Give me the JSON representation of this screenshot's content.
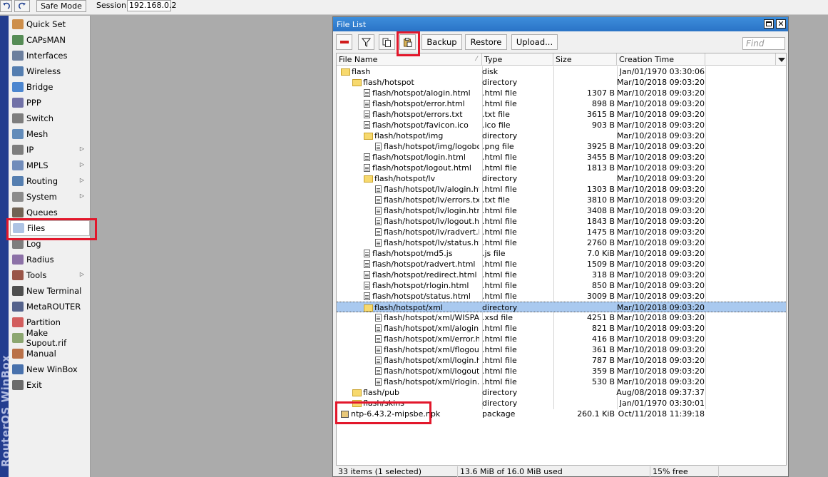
{
  "toolbar": {
    "undo_icon": "undo-icon",
    "redo_icon": "redo-icon",
    "safe_mode_label": "Safe Mode",
    "session_label": "Session:",
    "session_value": "192.168.0.2"
  },
  "brand_strip": "RouterOS WinBox",
  "sidebar": {
    "items": [
      {
        "label": "Quick Set",
        "icon": "quick-set-icon"
      },
      {
        "label": "CAPsMAN",
        "icon": "capsman-icon"
      },
      {
        "label": "Interfaces",
        "icon": "interfaces-icon"
      },
      {
        "label": "Wireless",
        "icon": "wireless-icon"
      },
      {
        "label": "Bridge",
        "icon": "bridge-icon"
      },
      {
        "label": "PPP",
        "icon": "ppp-icon"
      },
      {
        "label": "Switch",
        "icon": "switch-icon"
      },
      {
        "label": "Mesh",
        "icon": "mesh-icon"
      },
      {
        "label": "IP",
        "icon": "ip-icon",
        "submenu": true
      },
      {
        "label": "MPLS",
        "icon": "mpls-icon",
        "submenu": true
      },
      {
        "label": "Routing",
        "icon": "routing-icon",
        "submenu": true
      },
      {
        "label": "System",
        "icon": "system-icon",
        "submenu": true
      },
      {
        "label": "Queues",
        "icon": "queues-icon"
      },
      {
        "label": "Files",
        "icon": "files-icon",
        "selected": true
      },
      {
        "label": "Log",
        "icon": "log-icon"
      },
      {
        "label": "Radius",
        "icon": "radius-icon"
      },
      {
        "label": "Tools",
        "icon": "tools-icon",
        "submenu": true
      },
      {
        "label": "New Terminal",
        "icon": "terminal-icon"
      },
      {
        "label": "MetaROUTER",
        "icon": "metarouter-icon"
      },
      {
        "label": "Partition",
        "icon": "partition-icon"
      },
      {
        "label": "Make Supout.rif",
        "icon": "supout-icon"
      },
      {
        "label": "Manual",
        "icon": "manual-icon"
      },
      {
        "label": "New WinBox",
        "icon": "winbox-icon"
      },
      {
        "label": "Exit",
        "icon": "exit-icon"
      }
    ]
  },
  "file_window": {
    "title": "File List",
    "buttons": {
      "remove_icon": "remove-icon",
      "filter_icon": "filter-icon",
      "copy_icon": "copy-icon",
      "paste_icon": "paste-icon",
      "backup": "Backup",
      "restore": "Restore",
      "upload": "Upload..."
    },
    "find_placeholder": "Find",
    "columns": [
      "File Name",
      "Type",
      "Size",
      "Creation Time"
    ],
    "rows": [
      {
        "name": "flash",
        "type": "disk",
        "size": "",
        "time": "Jan/01/1970 03:30:06",
        "icon": "folder",
        "indent": 0
      },
      {
        "name": "flash/hotspot",
        "type": "directory",
        "size": "",
        "time": "Mar/10/2018 09:03:20",
        "icon": "folder",
        "indent": 1
      },
      {
        "name": "flash/hotspot/alogin.html",
        "type": ".html file",
        "size": "1307 B",
        "time": "Mar/10/2018 09:03:20",
        "icon": "file",
        "indent": 2
      },
      {
        "name": "flash/hotspot/error.html",
        "type": ".html file",
        "size": "898 B",
        "time": "Mar/10/2018 09:03:20",
        "icon": "file",
        "indent": 2
      },
      {
        "name": "flash/hotspot/errors.txt",
        "type": ".txt file",
        "size": "3615 B",
        "time": "Mar/10/2018 09:03:20",
        "icon": "file",
        "indent": 2
      },
      {
        "name": "flash/hotspot/favicon.ico",
        "type": ".ico file",
        "size": "903 B",
        "time": "Mar/10/2018 09:03:20",
        "icon": "file",
        "indent": 2
      },
      {
        "name": "flash/hotspot/img",
        "type": "directory",
        "size": "",
        "time": "Mar/10/2018 09:03:20",
        "icon": "folder",
        "indent": 2
      },
      {
        "name": "flash/hotspot/img/logobo...",
        "type": ".png file",
        "size": "3925 B",
        "time": "Mar/10/2018 09:03:20",
        "icon": "file",
        "indent": 3
      },
      {
        "name": "flash/hotspot/login.html",
        "type": ".html file",
        "size": "3455 B",
        "time": "Mar/10/2018 09:03:20",
        "icon": "file",
        "indent": 2
      },
      {
        "name": "flash/hotspot/logout.html",
        "type": ".html file",
        "size": "1813 B",
        "time": "Mar/10/2018 09:03:20",
        "icon": "file",
        "indent": 2
      },
      {
        "name": "flash/hotspot/lv",
        "type": "directory",
        "size": "",
        "time": "Mar/10/2018 09:03:20",
        "icon": "folder",
        "indent": 2
      },
      {
        "name": "flash/hotspot/lv/alogin.html",
        "type": ".html file",
        "size": "1303 B",
        "time": "Mar/10/2018 09:03:20",
        "icon": "file",
        "indent": 3
      },
      {
        "name": "flash/hotspot/lv/errors.txt",
        "type": ".txt file",
        "size": "3810 B",
        "time": "Mar/10/2018 09:03:20",
        "icon": "file",
        "indent": 3
      },
      {
        "name": "flash/hotspot/lv/login.html",
        "type": ".html file",
        "size": "3408 B",
        "time": "Mar/10/2018 09:03:20",
        "icon": "file",
        "indent": 3
      },
      {
        "name": "flash/hotspot/lv/logout.html",
        "type": ".html file",
        "size": "1843 B",
        "time": "Mar/10/2018 09:03:20",
        "icon": "file",
        "indent": 3
      },
      {
        "name": "flash/hotspot/lv/radvert.h",
        "type": ".html file",
        "size": "1475 B",
        "time": "Mar/10/2018 09:03:20",
        "icon": "file",
        "indent": 3
      },
      {
        "name": "flash/hotspot/lv/status.html",
        "type": ".html file",
        "size": "2760 B",
        "time": "Mar/10/2018 09:03:20",
        "icon": "file",
        "indent": 3
      },
      {
        "name": "flash/hotspot/md5.js",
        "type": ".js file",
        "size": "7.0 KiB",
        "time": "Mar/10/2018 09:03:20",
        "icon": "file",
        "indent": 2
      },
      {
        "name": "flash/hotspot/radvert.html",
        "type": ".html file",
        "size": "1509 B",
        "time": "Mar/10/2018 09:03:20",
        "icon": "file",
        "indent": 2
      },
      {
        "name": "flash/hotspot/redirect.html",
        "type": ".html file",
        "size": "318 B",
        "time": "Mar/10/2018 09:03:20",
        "icon": "file",
        "indent": 2
      },
      {
        "name": "flash/hotspot/rlogin.html",
        "type": ".html file",
        "size": "850 B",
        "time": "Mar/10/2018 09:03:20",
        "icon": "file",
        "indent": 2
      },
      {
        "name": "flash/hotspot/status.html",
        "type": ".html file",
        "size": "3009 B",
        "time": "Mar/10/2018 09:03:20",
        "icon": "file",
        "indent": 2
      },
      {
        "name": "flash/hotspot/xml",
        "type": "directory",
        "size": "",
        "time": "Mar/10/2018 09:03:20",
        "icon": "folder",
        "indent": 2,
        "selected": true
      },
      {
        "name": "flash/hotspot/xml/WISPA...",
        "type": ".xsd file",
        "size": "4251 B",
        "time": "Mar/10/2018 09:03:20",
        "icon": "file",
        "indent": 3
      },
      {
        "name": "flash/hotspot/xml/alogin....",
        "type": ".html file",
        "size": "821 B",
        "time": "Mar/10/2018 09:03:20",
        "icon": "file",
        "indent": 3
      },
      {
        "name": "flash/hotspot/xml/error.html",
        "type": ".html file",
        "size": "416 B",
        "time": "Mar/10/2018 09:03:20",
        "icon": "file",
        "indent": 3
      },
      {
        "name": "flash/hotspot/xml/flogout....",
        "type": ".html file",
        "size": "361 B",
        "time": "Mar/10/2018 09:03:20",
        "icon": "file",
        "indent": 3
      },
      {
        "name": "flash/hotspot/xml/login.html",
        "type": ".html file",
        "size": "787 B",
        "time": "Mar/10/2018 09:03:20",
        "icon": "file",
        "indent": 3
      },
      {
        "name": "flash/hotspot/xml/logout....",
        "type": ".html file",
        "size": "359 B",
        "time": "Mar/10/2018 09:03:20",
        "icon": "file",
        "indent": 3
      },
      {
        "name": "flash/hotspot/xml/rlogin.h",
        "type": ".html file",
        "size": "530 B",
        "time": "Mar/10/2018 09:03:20",
        "icon": "file",
        "indent": 3
      },
      {
        "name": "flash/pub",
        "type": "directory",
        "size": "",
        "time": "Aug/08/2018 09:37:37",
        "icon": "folder",
        "indent": 1
      },
      {
        "name": "flash/skins",
        "type": "directory",
        "size": "",
        "time": "Jan/01/1970 03:30:01",
        "icon": "folder",
        "indent": 1
      },
      {
        "name": "ntp-6.43.2-mipsbe.npk",
        "type": "package",
        "size": "260.1 KiB",
        "time": "Oct/11/2018 11:39:18",
        "icon": "package",
        "indent": 0
      }
    ],
    "status": {
      "items": "33 items (1 selected)",
      "usage": "13.6 MiB of 16.0 MiB used",
      "free": "15% free"
    }
  },
  "colors": {
    "highlight_box": "#e2172b",
    "selection": "#a9c9ef",
    "title_bar": "#2a73c6",
    "brand_strip": "#233d8f"
  }
}
